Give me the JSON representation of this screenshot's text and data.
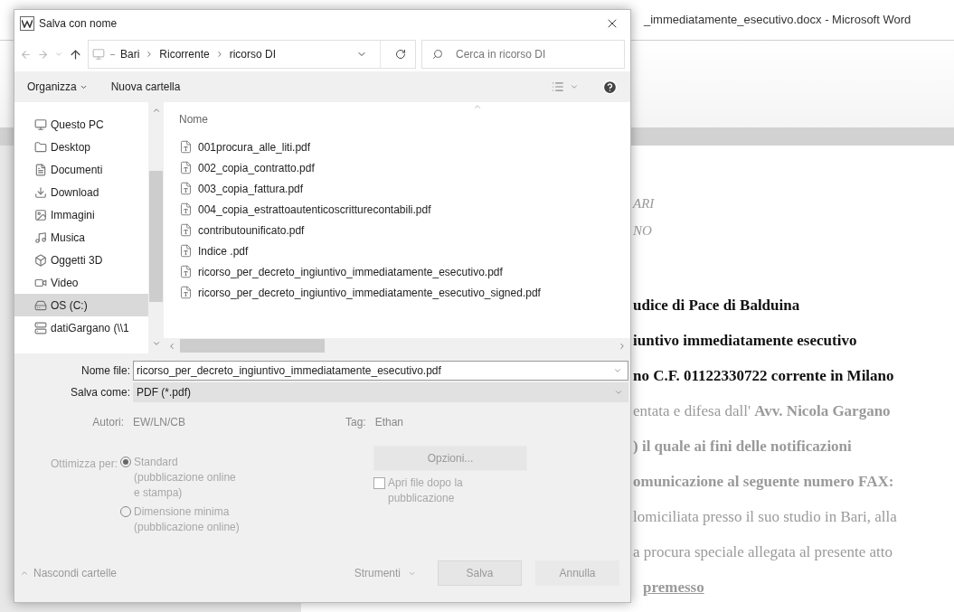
{
  "word_window": {
    "title": "_immediatamente_esecutivo.docx - Microsoft Word",
    "document_lines": [
      {
        "kind": "italic",
        "text": "ARI",
        "dim": true
      },
      {
        "kind": "italic",
        "text": "NO",
        "dim": true
      },
      {
        "kind": "bold",
        "text": "udice di Pace di Balduina",
        "dim": false
      },
      {
        "kind": "bold",
        "text": "iuntivo immediatamente esecutivo",
        "dim": false
      },
      {
        "kind": "bold",
        "text": "no C.F. 01122330722 corrente in Milano",
        "dim": false
      },
      {
        "kind": "plain",
        "text": "entata e difesa dall' **Avv. Nicola Gargano**",
        "dim": true
      },
      {
        "kind": "bold",
        "text": ") il quale  ai fini delle notificazioni",
        "dim": true
      },
      {
        "kind": "bold",
        "text": "omunicazione al seguente numero FAX:",
        "dim": true
      },
      {
        "kind": "plain",
        "text": "lomiciliata presso il suo studio in Bari,  alla",
        "dim": true
      },
      {
        "kind": "plain",
        "text": "a procura speciale allegata al presente atto",
        "dim": true
      },
      {
        "kind": "underlined",
        "text": "premesso",
        "dim": true
      }
    ]
  },
  "dialog": {
    "title": "Salva con nome",
    "breadcrumb": [
      "Bari",
      "Ricorrente",
      "ricorso DI"
    ],
    "search": {
      "placeholder": "Cerca in ricorso DI"
    },
    "toolbar": {
      "organize": "Organizza",
      "new_folder": "Nuova cartella"
    },
    "sidebar": {
      "items": [
        {
          "label": "Questo PC",
          "selected": false
        },
        {
          "label": "Desktop",
          "selected": false
        },
        {
          "label": "Documenti",
          "selected": false
        },
        {
          "label": "Download",
          "selected": false
        },
        {
          "label": "Immagini",
          "selected": false
        },
        {
          "label": "Musica",
          "selected": false
        },
        {
          "label": "Oggetti 3D",
          "selected": false
        },
        {
          "label": "Video",
          "selected": false
        },
        {
          "label": "OS (C:)",
          "selected": true
        },
        {
          "label": "datiGargano (\\\\1",
          "selected": false
        }
      ]
    },
    "file_list": {
      "column": "Nome",
      "files": [
        "001procura_alle_liti.pdf",
        "002_copia_contratto.pdf",
        "003_copia_fattura.pdf",
        "004_copia_estrattoautenticoscritturecontabili.pdf",
        "contributounificato.pdf",
        "Indice .pdf",
        "ricorso_per_decreto_ingiuntivo_immediatamente_esecutivo.pdf",
        "ricorso_per_decreto_ingiuntivo_immediatamente_esecutivo_signed.pdf"
      ]
    },
    "file_name": {
      "label": "Nome file:",
      "value": "ricorso_per_decreto_ingiuntivo_immediatamente_esecutivo.pdf"
    },
    "save_as": {
      "label": "Salva come:",
      "value": "PDF (*.pdf)"
    },
    "authors": {
      "label": "Autori:",
      "value": "EW/LN/CB"
    },
    "tags": {
      "label": "Tag:",
      "value": "Ethan"
    },
    "optimize": {
      "label": "Ottimizza per:",
      "options": [
        {
          "lines": [
            "Standard",
            "(pubblicazione online",
            "e stampa)"
          ],
          "selected": true
        },
        {
          "lines": [
            "Dimensione minima",
            "(pubblicazione online)"
          ],
          "selected": false
        }
      ]
    },
    "options_button": "Opzioni...",
    "open_after": {
      "lines": [
        "Apri file dopo la",
        "pubblicazione"
      ],
      "checked": false
    },
    "hide_folders": "Nascondi cartelle",
    "tools": "Strumenti",
    "buttons": [
      "Salva",
      "Annulla"
    ]
  }
}
